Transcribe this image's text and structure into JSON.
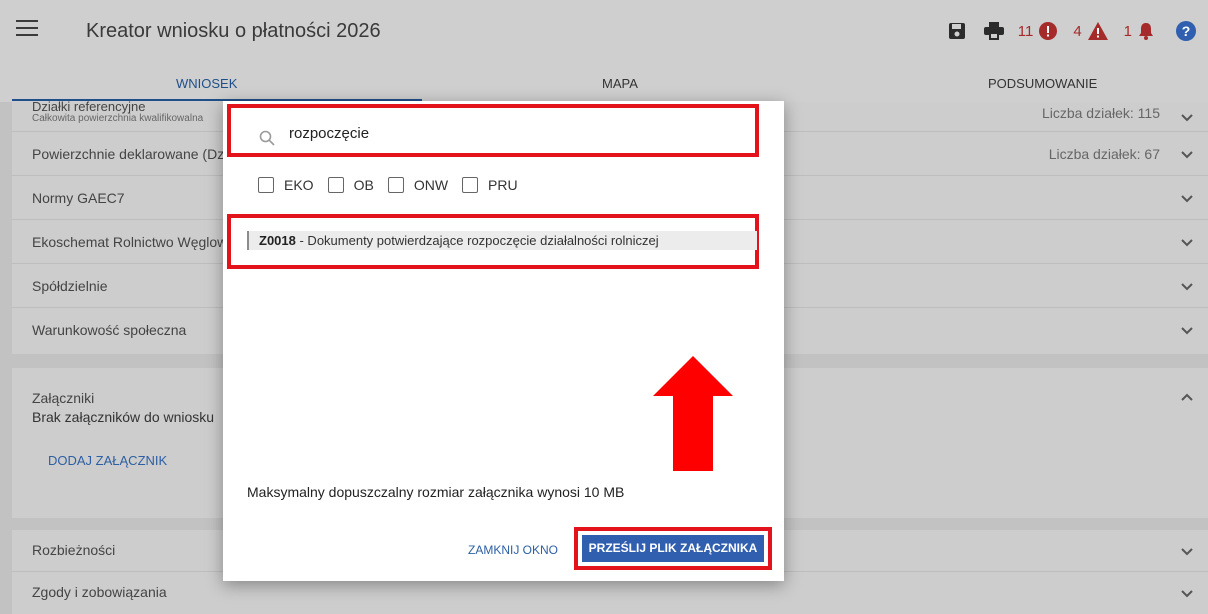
{
  "header": {
    "title": "Kreator wniosku o płatności 2026",
    "errors_count": "11",
    "warnings_count": "4",
    "notifications_count": "1",
    "icons": [
      "menu-icon",
      "save-icon",
      "print-icon",
      "error-icon",
      "warning-icon",
      "bell-icon",
      "help-icon"
    ]
  },
  "tabs": [
    {
      "label": "WNIOSEK",
      "active": true
    },
    {
      "label": "MAPA",
      "active": false
    },
    {
      "label": "PODSUMOWANIE",
      "active": false
    }
  ],
  "sections": {
    "dzialki": {
      "label": "Działki referencyjne",
      "sublabel": "Całkowita powierzchnia kwalifikowalna",
      "meta": "Liczba działek: 115"
    },
    "powierzchnie": {
      "label": "Powierzchnie deklarowane (Dz",
      "meta": "Liczba działek: 67"
    },
    "gaec": {
      "label": "Normy GAEC7"
    },
    "ekoschemat": {
      "label": "Ekoschemat Rolnictwo Węglow"
    },
    "spoldzielnie": {
      "label": "Spółdzielnie"
    },
    "warunkowosc": {
      "label": "Warunkowość społeczna"
    },
    "zalaczniki": {
      "label": "Załączniki",
      "sublabel": "Brak załączników do wniosku",
      "button": "DODAJ ZAŁĄCZNIK"
    },
    "rozbieznosci": {
      "label": "Rozbieżności"
    },
    "zgody": {
      "label": "Zgody i zobowiązania"
    }
  },
  "modal": {
    "search_value": "rozpoczęcie",
    "filters": [
      "EKO",
      "OB",
      "ONW",
      "PRU"
    ],
    "result_code": "Z0018",
    "result_text": " - Dokumenty potwierdzające rozpoczęcie działalności rolniczej",
    "note": "Maksymalny dopuszczalny rozmiar załącznika wynosi 10 MB",
    "close_label": "ZAMKNIJ OKNO",
    "upload_label": "PRZEŚLIJ PLIK ZAŁĄCZNIKA"
  },
  "colors": {
    "primary": "#2f5fae",
    "highlight": "#e3131b",
    "error": "#a52a2a"
  }
}
